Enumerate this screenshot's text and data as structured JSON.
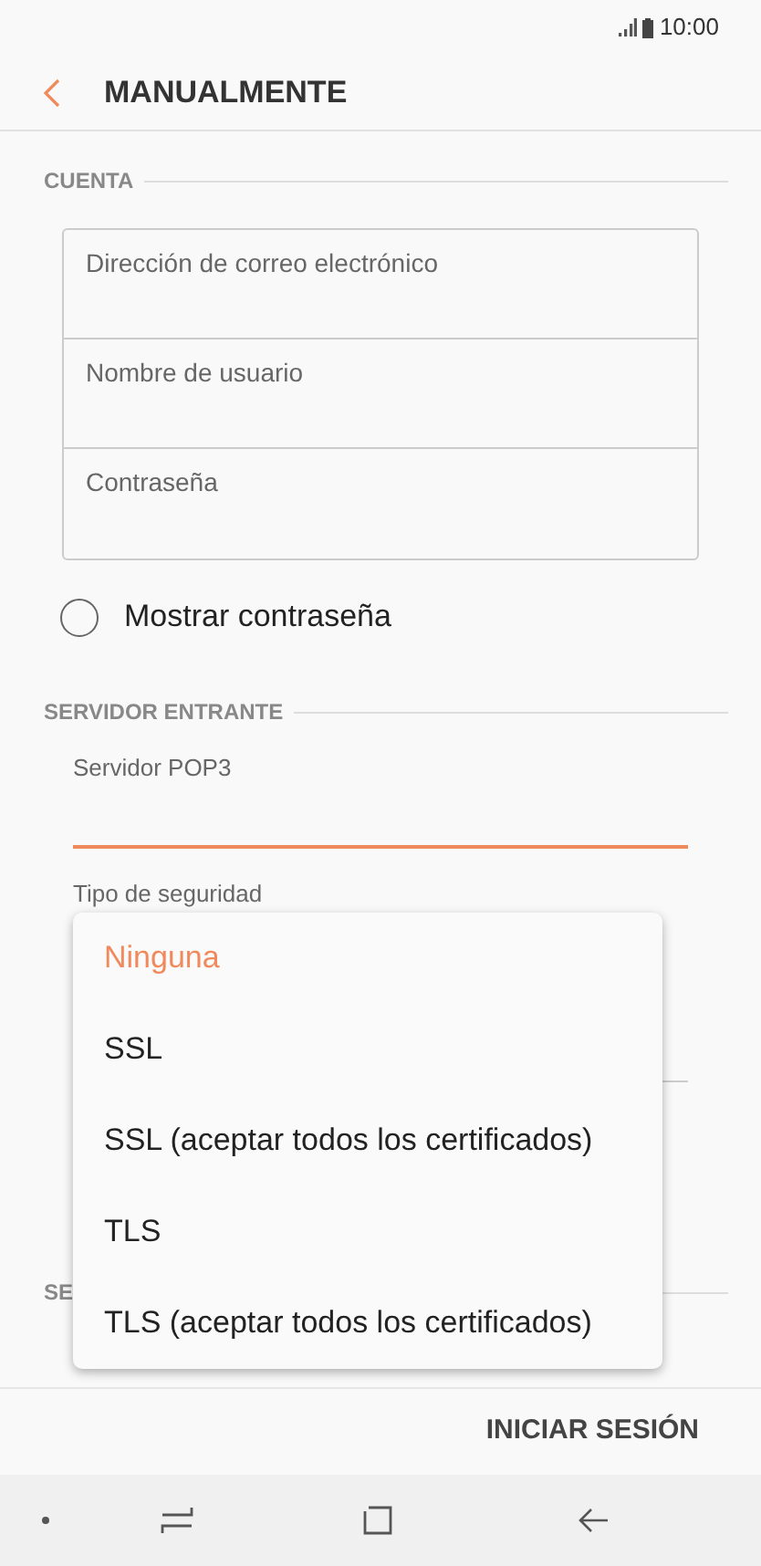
{
  "status_bar": {
    "time": "10:00"
  },
  "header": {
    "title": "MANUALMENTE"
  },
  "account": {
    "label": "CUENTA",
    "fields": [
      {
        "placeholder": "Dirección de correo electrónico"
      },
      {
        "placeholder": "Nombre de usuario"
      },
      {
        "placeholder": "Contraseña"
      }
    ],
    "show_password": {
      "label": "Mostrar contraseña",
      "checked": false
    }
  },
  "incoming": {
    "label": "SERVIDOR ENTRANTE",
    "server_field": {
      "label": "Servidor POP3",
      "focused": true
    },
    "security_label": "Tipo de seguridad"
  },
  "outgoing": {
    "label": "SE"
  },
  "dropdown": {
    "options": [
      {
        "label": "Ninguna",
        "selected": true
      },
      {
        "label": "SSL",
        "selected": false
      },
      {
        "label": "SSL (aceptar todos los certificados)",
        "selected": false
      },
      {
        "label": "TLS",
        "selected": false
      },
      {
        "label": "TLS (aceptar todos los certificados)",
        "selected": false
      }
    ]
  },
  "footer": {
    "button": "INICIAR SESIÓN"
  }
}
